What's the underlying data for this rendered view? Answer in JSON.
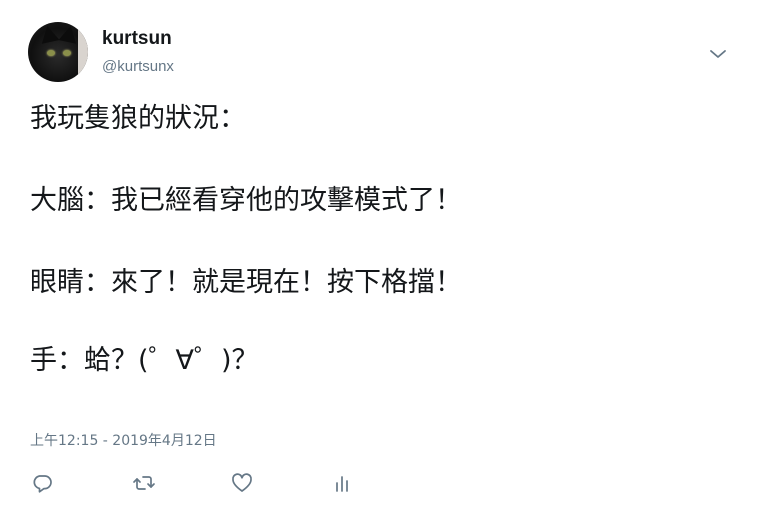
{
  "user": {
    "display_name": "kurtsun",
    "handle": "@kurtsunx"
  },
  "tweet": {
    "lines": [
      "我玩隻狼的狀況：",
      "大腦：我已經看穿他的攻擊模式了！",
      "眼睛：來了！就是現在！按下格擋！",
      "手：蛤？(゜∀゜)？"
    ],
    "timestamp": "上午12:15 - 2019年4月12日"
  },
  "icons": {
    "menu": "chevron-down-icon",
    "reply": "reply-icon",
    "retweet": "retweet-icon",
    "like": "heart-icon",
    "analytics": "analytics-icon"
  },
  "colors": {
    "text": "#14171a",
    "secondary": "#657786"
  }
}
